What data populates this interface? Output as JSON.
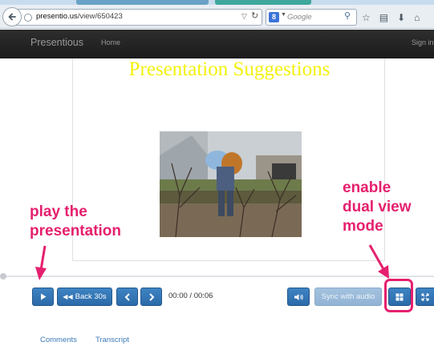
{
  "browser": {
    "url_host": "presentio.us",
    "url_path": "/view/650423",
    "search_engine_badge": "8",
    "search_placeholder": "Google",
    "icons": [
      "back-arrow-icon",
      "globe-icon",
      "reload-icon",
      "search-magnifier-icon",
      "star-icon",
      "clipboard-icon",
      "download-icon",
      "home-icon"
    ]
  },
  "site_nav": {
    "brand": "Presentious",
    "home_label": "Home",
    "signin_label": "Sign in"
  },
  "slide": {
    "title": "Presentation Suggestions"
  },
  "controls": {
    "back30_label": "Back 30s",
    "time": "00:00 / 00:06",
    "sync_label": "Sync with audio",
    "accent_color": "#3579ba",
    "icons": [
      "play-icon",
      "rewind-icon",
      "chevron-left-icon",
      "chevron-right-icon",
      "volume-icon",
      "dual-view-icon",
      "fullscreen-icon"
    ]
  },
  "annotations": {
    "play_line1": "play the",
    "play_line2": "presentation",
    "dual_line1": "enable",
    "dual_line2": "dual view",
    "dual_line3": "mode",
    "color": "#e5206e"
  },
  "bottom_tabs": {
    "comments": "Comments",
    "transcript": "Transcript"
  }
}
